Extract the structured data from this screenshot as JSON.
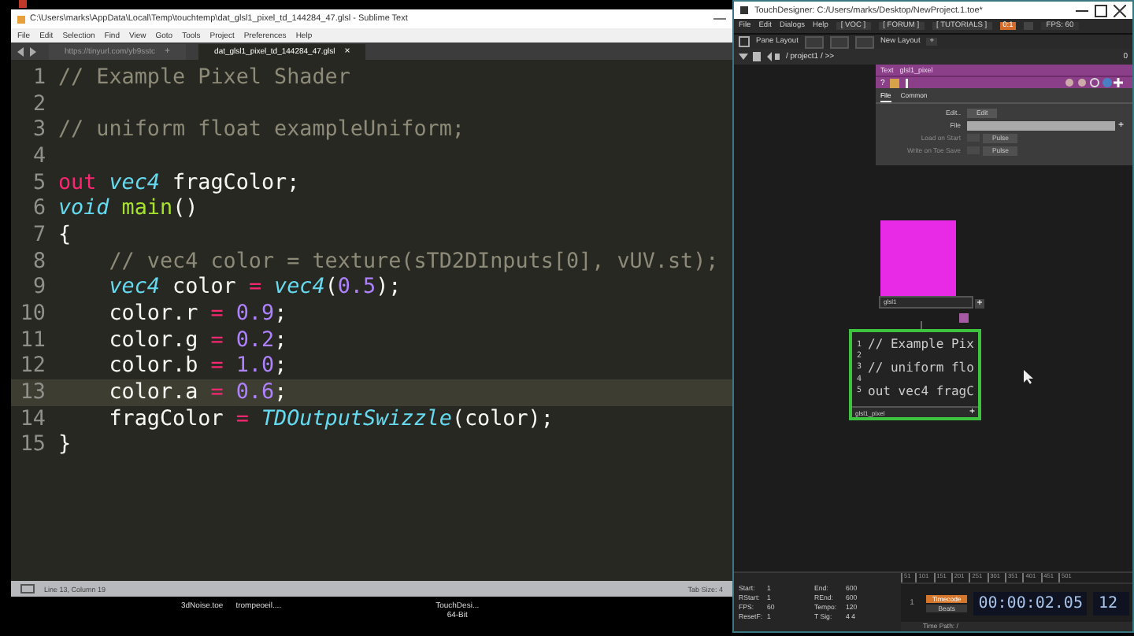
{
  "sublime": {
    "title": "C:\\Users\\marks\\AppData\\Local\\Temp\\touchtemp\\dat_glsl1_pixel_td_144284_47.glsl - Sublime Text",
    "menu": [
      "File",
      "Edit",
      "Selection",
      "Find",
      "View",
      "Goto",
      "Tools",
      "Project",
      "Preferences",
      "Help"
    ],
    "tabs": [
      {
        "label": "https://tinyurl.com/yb9sstc",
        "selected": false,
        "close": "+"
      },
      {
        "label": "dat_glsl1_pixel_td_144284_47.glsl",
        "selected": true,
        "close": "×"
      }
    ],
    "lines": [
      {
        "number": "1",
        "current": false,
        "tokens": [
          {
            "kind": "comment",
            "text": "// Example Pixel Shader"
          }
        ]
      },
      {
        "number": "2",
        "current": false
      },
      {
        "number": "3",
        "current": false,
        "tokens": [
          {
            "kind": "comment",
            "text": "// uniform float exampleUniform;"
          }
        ]
      },
      {
        "number": "4",
        "current": false
      },
      {
        "number": "5",
        "current": false,
        "tokens": [
          {
            "kind": "keyword",
            "text": "out"
          },
          {
            "kind": "type",
            "text": " vec4"
          },
          {
            "kind": "plain",
            "text": " fragColor;"
          }
        ]
      },
      {
        "number": "6",
        "current": false,
        "tokens": [
          {
            "kind": "type",
            "text": "void"
          },
          {
            "kind": "func",
            "text": " main"
          },
          {
            "kind": "plain",
            "text": "()"
          }
        ]
      },
      {
        "number": "7",
        "current": false,
        "tokens": [
          {
            "kind": "plain",
            "text": "{"
          }
        ]
      },
      {
        "number": "8",
        "current": false,
        "tokens": [
          {
            "kind": "comment",
            "text": "    // vec4 color = texture(sTD2DInputs[0], vUV.st);"
          }
        ]
      },
      {
        "number": "9",
        "current": false,
        "tokens": [
          {
            "kind": "type",
            "text": "    vec4"
          },
          {
            "kind": "plain",
            "text": " color "
          },
          {
            "kind": "keyword",
            "text": "="
          },
          {
            "kind": "type",
            "text": " vec4"
          },
          {
            "kind": "plain",
            "text": "("
          },
          {
            "kind": "number",
            "text": "0.5"
          },
          {
            "kind": "plain",
            "text": ");"
          }
        ]
      },
      {
        "number": "10",
        "current": false,
        "tokens": [
          {
            "kind": "plain",
            "text": "    color.r "
          },
          {
            "kind": "keyword",
            "text": "="
          },
          {
            "kind": "number",
            "text": " 0.9"
          },
          {
            "kind": "plain",
            "text": ";"
          }
        ]
      },
      {
        "number": "11",
        "current": false,
        "tokens": [
          {
            "kind": "plain",
            "text": "    color.g "
          },
          {
            "kind": "keyword",
            "text": "="
          },
          {
            "kind": "number",
            "text": " 0.2"
          },
          {
            "kind": "plain",
            "text": ";"
          }
        ]
      },
      {
        "number": "12",
        "current": false,
        "tokens": [
          {
            "kind": "plain",
            "text": "    color.b "
          },
          {
            "kind": "keyword",
            "text": "="
          },
          {
            "kind": "number",
            "text": " 1.0"
          },
          {
            "kind": "plain",
            "text": ";"
          }
        ]
      },
      {
        "number": "13",
        "current": true,
        "tokens": [
          {
            "kind": "plain",
            "text": "    color.a "
          },
          {
            "kind": "keyword",
            "text": "="
          },
          {
            "kind": "number",
            "text": " 0.6"
          },
          {
            "kind": "plain",
            "text": ";"
          }
        ]
      },
      {
        "number": "14",
        "current": false,
        "tokens": [
          {
            "kind": "plain",
            "text": "    fragColor "
          },
          {
            "kind": "keyword",
            "text": "="
          },
          {
            "kind": "type",
            "text": " TDOutputSwizzle"
          },
          {
            "kind": "plain",
            "text": "(color);"
          }
        ]
      },
      {
        "number": "15",
        "current": false,
        "tokens": [
          {
            "kind": "plain",
            "text": "}"
          }
        ]
      }
    ],
    "status_left": "Line 13, Column 19",
    "status_right": "Tab Size: 4"
  },
  "taskbar": [
    {
      "label": "3dNoise.toe"
    },
    {
      "label": "trompeoeil...."
    },
    {
      "label": "TouchDesi...",
      "sublabel": "64-Bit"
    }
  ],
  "touchdesigner": {
    "title": "TouchDesigner: C:/Users/marks/Desktop/NewProject.1.toe*",
    "menu": [
      "File",
      "Edit",
      "Dialogs",
      "Help"
    ],
    "links": [
      "[ VOC ]",
      "[ FORUM ]",
      "[ TUTORIALS ]"
    ],
    "indicator": "0:1",
    "fps": "FPS: 60",
    "toolbar": [
      "Pane Layout",
      "New Layout"
    ],
    "add": "+",
    "path": "/ project1 / >>",
    "pane_count": "0",
    "panel": {
      "type": "Text",
      "name": "glsl1_pixel",
      "help": "?",
      "tabs": [
        {
          "label": "File",
          "selected": true
        },
        {
          "label": "Common",
          "selected": false
        }
      ],
      "params": [
        {
          "kind": "button",
          "label": "Edit..",
          "value": "Edit",
          "disabled": false
        },
        {
          "kind": "field",
          "label": "File",
          "add": "+",
          "disabled": false
        },
        {
          "kind": "toggle",
          "label": "Load on Start",
          "value": "Pulse",
          "disabled": true
        },
        {
          "kind": "toggle",
          "label": "Write on Toe Save",
          "value": "Pulse",
          "disabled": true
        }
      ]
    },
    "nodes": [
      {
        "kind": "top",
        "name": "glsl1",
        "output": "+",
        "color": "#e829e6"
      },
      {
        "kind": "dat",
        "name": "glsl1_pixel",
        "output": "+",
        "lines": [
          {
            "number": "1",
            "text": "// Example Pix"
          },
          {
            "number": "2"
          },
          {
            "number": "3",
            "text": "// uniform flo"
          },
          {
            "number": "4"
          },
          {
            "number": "5",
            "text": "out vec4 fragC"
          }
        ]
      }
    ],
    "info": [
      {
        "label": "Start:",
        "value": "1"
      },
      {
        "label": "End:",
        "value": "600"
      },
      {
        "label": "RStart:",
        "value": "1"
      },
      {
        "label": "REnd:",
        "value": "600"
      },
      {
        "label": "FPS:",
        "value": "60"
      },
      {
        "label": "Tempo:",
        "value": "120"
      },
      {
        "label": "ResetF:",
        "value": "1"
      },
      {
        "label": "T Sig:",
        "value": "4  4"
      }
    ],
    "ticks": [
      "51",
      "101",
      "151",
      "201",
      "251",
      "301",
      "351",
      "401",
      "451",
      "501"
    ],
    "frame_start": "1",
    "modes": [
      {
        "label": "Timecode",
        "selected": true
      },
      {
        "label": "Beats",
        "selected": false
      }
    ],
    "time": "00:00:02.05",
    "frame": "12",
    "time_path": "Time Path: /"
  }
}
